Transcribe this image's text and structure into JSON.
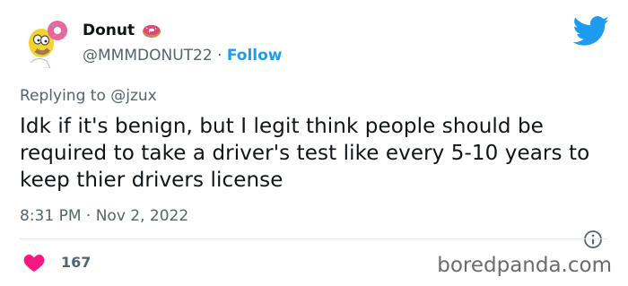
{
  "tweet": {
    "author_name": "Donut",
    "author_handle": "@MMMDONUT22",
    "separator": "·",
    "follow_label": "Follow",
    "replying_prefix": "Replying to",
    "replying_handle": "@jzux",
    "text": "Idk if it's benign, but I legit think people should be required to take a driver's test like every 5-10 years to keep thier drivers license",
    "time": "8:31 PM",
    "date": "Nov 2, 2022",
    "like_count": "167"
  },
  "watermark": "boredpanda.com",
  "colors": {
    "accent": "#1d9bf0",
    "heart": "#f91880",
    "muted": "#536471",
    "text": "#0f1419"
  },
  "icons": [
    "avatar-homer-donut",
    "donut-emoji-icon",
    "twitter-bird-icon",
    "info-icon",
    "heart-icon"
  ]
}
